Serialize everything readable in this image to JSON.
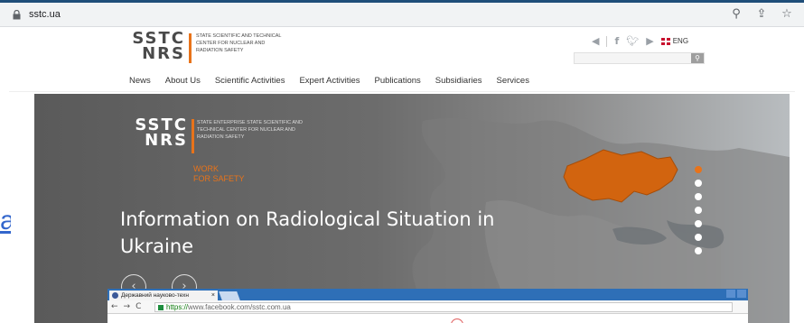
{
  "browser": {
    "url": "sstc.ua",
    "icons": [
      "zoom-icon",
      "share-icon",
      "star-icon"
    ]
  },
  "site": {
    "logo": {
      "acronym_line1": "SSTC",
      "acronym_line2": "NRS",
      "text": "STATE SCIENTIFIC AND TECHNICAL CENTER FOR NUCLEAR AND RADIATION SAFETY"
    },
    "language": "ENG",
    "nav": [
      "News",
      "About Us",
      "Scientific Activities",
      "Expert Activities",
      "Publications",
      "Subsidiaries",
      "Services"
    ]
  },
  "left_link": "a",
  "hero": {
    "logo": {
      "acronym_line1": "SSTC",
      "acronym_line2": "NRS",
      "text": "STATE ENTERPRISE STATE SCIENTIFIC AND TECHNICAL CENTER FOR NUCLEAR AND RADIATION SAFETY"
    },
    "slogan_line1": "WORK",
    "slogan_line2": "FOR SAFETY",
    "title": "Information on Radiological Situation in Ukraine",
    "slides_count": 7,
    "active_slide": 1,
    "accent_color": "#e8731a"
  },
  "embedded_browser": {
    "tab_title": "Державний науково-техн",
    "url_prefix": "https://",
    "url_host": "www.facebook.com",
    "url_path": "/sstc.com.ua"
  }
}
